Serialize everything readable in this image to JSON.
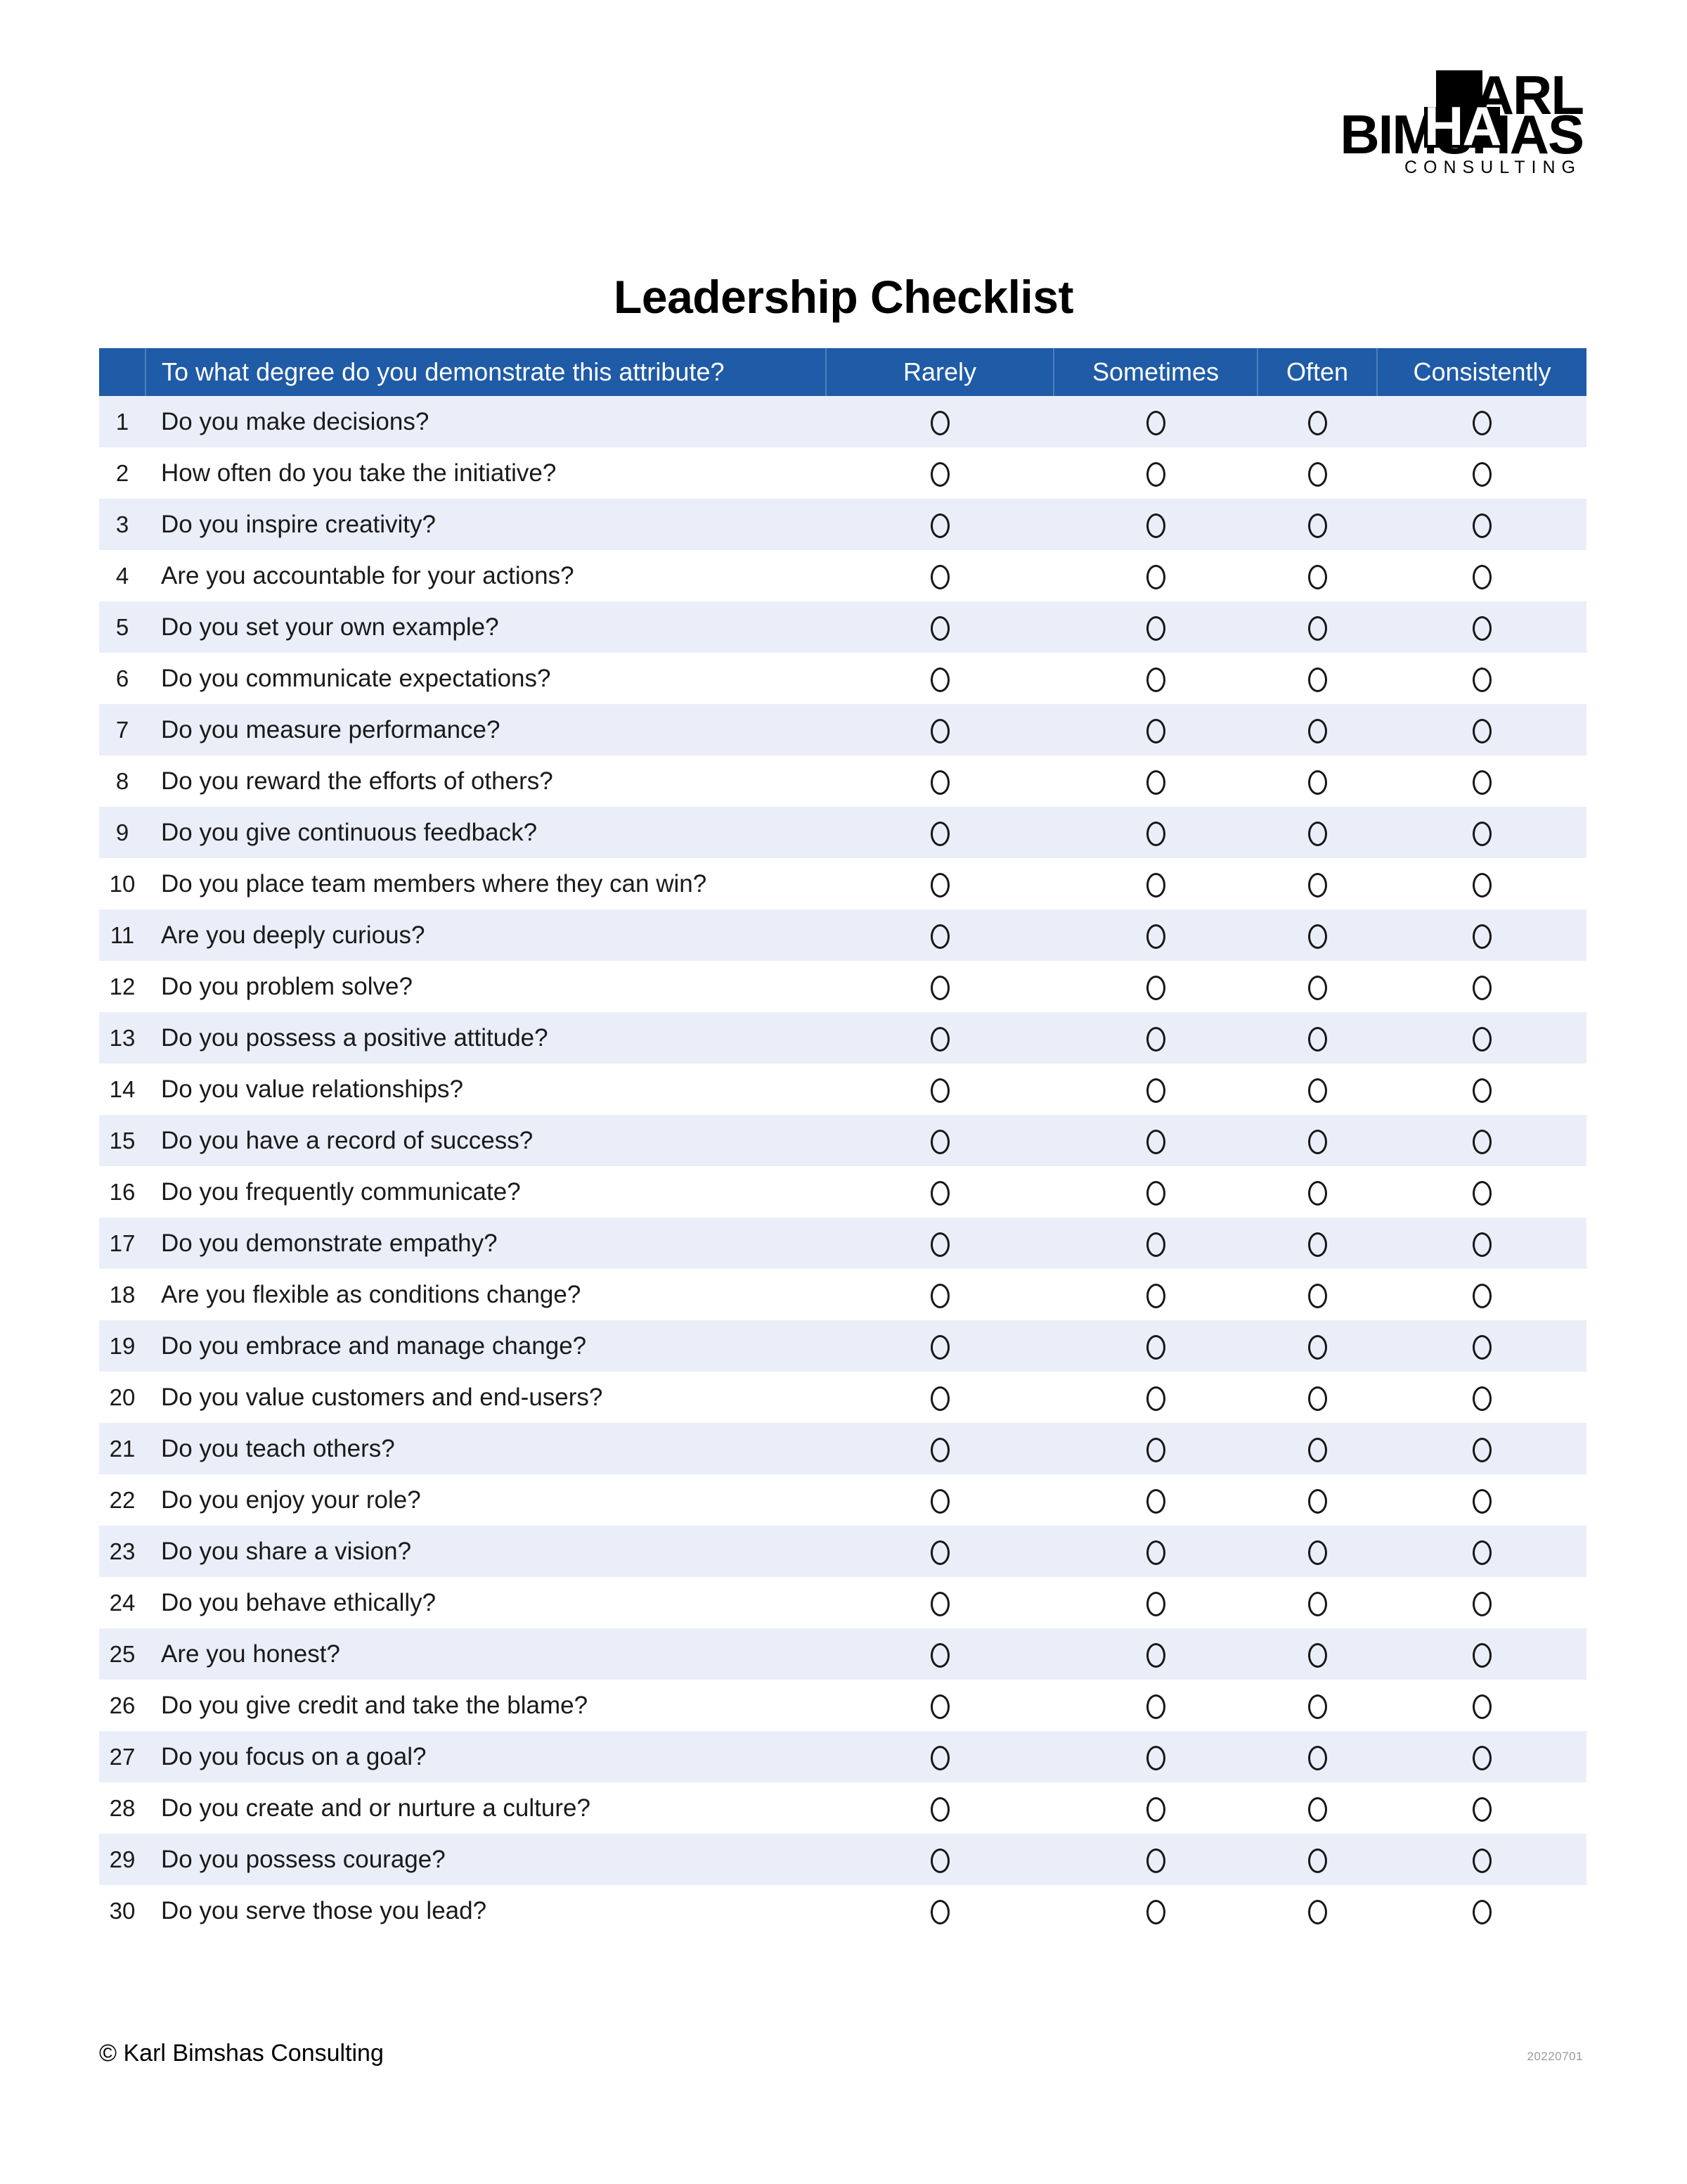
{
  "brand": {
    "logo_line1": "KARL",
    "logo_line2": "BIMSHAS",
    "logo_overlap": "HA",
    "logo_tagline": "CONSULTING"
  },
  "page": {
    "title": "Leadership Checklist"
  },
  "colors": {
    "header_blue": "#1F5BA6",
    "header_divider": "#4C80BD",
    "row_stripe": "#EAEEF8",
    "row_plain": "#FFFFFF",
    "text": "#1A1A1A",
    "version_gray": "#9A9A9A"
  },
  "table": {
    "columns": {
      "number": "",
      "question": "To what degree do you demonstrate this attribute?",
      "options": [
        "Rarely",
        "Sometimes",
        "Often",
        "Consistently"
      ]
    },
    "rows": [
      {
        "num": "1",
        "question": "Do you make decisions?"
      },
      {
        "num": "2",
        "question": "How often do you take the initiative?"
      },
      {
        "num": "3",
        "question": "Do you inspire creativity?"
      },
      {
        "num": "4",
        "question": "Are you accountable for your actions?"
      },
      {
        "num": "5",
        "question": "Do you set your own example?"
      },
      {
        "num": "6",
        "question": "Do you communicate expectations?"
      },
      {
        "num": "7",
        "question": "Do you measure performance?"
      },
      {
        "num": "8",
        "question": "Do you reward the efforts of others?"
      },
      {
        "num": "9",
        "question": "Do you give continuous feedback?"
      },
      {
        "num": "10",
        "question": "Do you place team members where they can win?"
      },
      {
        "num": "11",
        "question": "Are you deeply curious?"
      },
      {
        "num": "12",
        "question": "Do you problem solve?"
      },
      {
        "num": "13",
        "question": "Do you possess a positive attitude?"
      },
      {
        "num": "14",
        "question": "Do you value relationships?"
      },
      {
        "num": "15",
        "question": "Do you have a record of success?"
      },
      {
        "num": "16",
        "question": "Do you frequently communicate?"
      },
      {
        "num": "17",
        "question": "Do you demonstrate empathy?"
      },
      {
        "num": "18",
        "question": "Are you flexible as conditions change?"
      },
      {
        "num": "19",
        "question": "Do you embrace and manage change?"
      },
      {
        "num": "20",
        "question": "Do you value customers and end-users?"
      },
      {
        "num": "21",
        "question": "Do you teach others?"
      },
      {
        "num": "22",
        "question": "Do you enjoy your role?"
      },
      {
        "num": "23",
        "question": "Do you share a vision?"
      },
      {
        "num": "24",
        "question": "Do you behave ethically?"
      },
      {
        "num": "25",
        "question": "Are you honest?"
      },
      {
        "num": "26",
        "question": "Do you give credit and take the blame?"
      },
      {
        "num": "27",
        "question": "Do you focus on a goal?"
      },
      {
        "num": "28",
        "question": "Do you create and or nurture a culture?"
      },
      {
        "num": "29",
        "question": "Do you possess courage?"
      },
      {
        "num": "30",
        "question": "Do you serve those you lead?"
      }
    ]
  },
  "footer": {
    "copyright": "© Karl Bimshas Consulting",
    "version": "20220701"
  }
}
